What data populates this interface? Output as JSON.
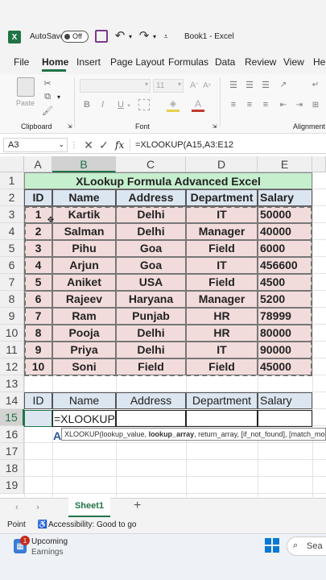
{
  "titlebar": {
    "autosave_label": "AutoSave",
    "autosave_state": "Off",
    "filename": "Book1",
    "app": "Excel",
    "separator": "-"
  },
  "ribbon_tabs": [
    "File",
    "Home",
    "Insert",
    "Page Layout",
    "Formulas",
    "Data",
    "Review",
    "View",
    "Help"
  ],
  "ribbon_groups": {
    "clipboard": "Clipboard",
    "paste": "Paste",
    "font": "Font",
    "alignment": "Alignment",
    "font_size": "11",
    "bold": "B",
    "italic": "I",
    "underline": "U"
  },
  "formula_bar": {
    "name_box": "A3",
    "fx": "fx",
    "formula": "=XLOOKUP(A15,A3:E12"
  },
  "columns": [
    "A",
    "B",
    "C",
    "D",
    "E"
  ],
  "rows": [
    "1",
    "2",
    "3",
    "4",
    "5",
    "6",
    "7",
    "8",
    "9",
    "10",
    "11",
    "12",
    "13",
    "14",
    "15",
    "16",
    "17",
    "18",
    "19"
  ],
  "table_title": "XLookup Formula Advanced Excel",
  "headers": [
    "ID",
    "Name",
    "Address",
    "Department",
    "Salary"
  ],
  "records": [
    [
      "1",
      "Kartik",
      "Delhi",
      "IT",
      "50000"
    ],
    [
      "2",
      "Salman",
      "Delhi",
      "Manager",
      "40000"
    ],
    [
      "3",
      "Pihu",
      "Goa",
      "Field",
      "6000"
    ],
    [
      "4",
      "Arjun",
      "Goa",
      "IT",
      "456600"
    ],
    [
      "5",
      "Aniket",
      "USA",
      "Field",
      "4500"
    ],
    [
      "6",
      "Rajeev",
      "Haryana",
      "Manager",
      "5200"
    ],
    [
      "7",
      "Ram",
      "Punjab",
      "HR",
      "78999"
    ],
    [
      "8",
      "Pooja",
      "Delhi",
      "HR",
      "80000"
    ],
    [
      "9",
      "Priya",
      "Delhi",
      "IT",
      "90000"
    ],
    [
      "10",
      "Soni",
      "Field",
      "Field",
      "45000"
    ]
  ],
  "lookup_headers": [
    "ID",
    "Name",
    "Address",
    "Department",
    "Salary"
  ],
  "editing_cell": "=XLOOKUP(",
  "row16_fragment": "A",
  "tooltip": {
    "func": "XLOOKUP(",
    "arg1": "lookup_value, ",
    "arg2_bold": "lookup_array",
    "rest": ", return_array, [if_not_found], [match_mod"
  },
  "sheetbar": {
    "sheet": "Sheet1",
    "add": "+"
  },
  "statusbar": {
    "mode": "Point",
    "accessibility": "Accessibility: Good to go"
  },
  "taskbar": {
    "badge": "1",
    "widget_title": "Upcoming",
    "widget_sub": "Earnings",
    "search": "Sea"
  },
  "colors": {
    "title_fill": "#c6efce",
    "header_fill": "#dce6f1",
    "data_fill": "#f2dcdb",
    "excel_green": "#217346"
  }
}
